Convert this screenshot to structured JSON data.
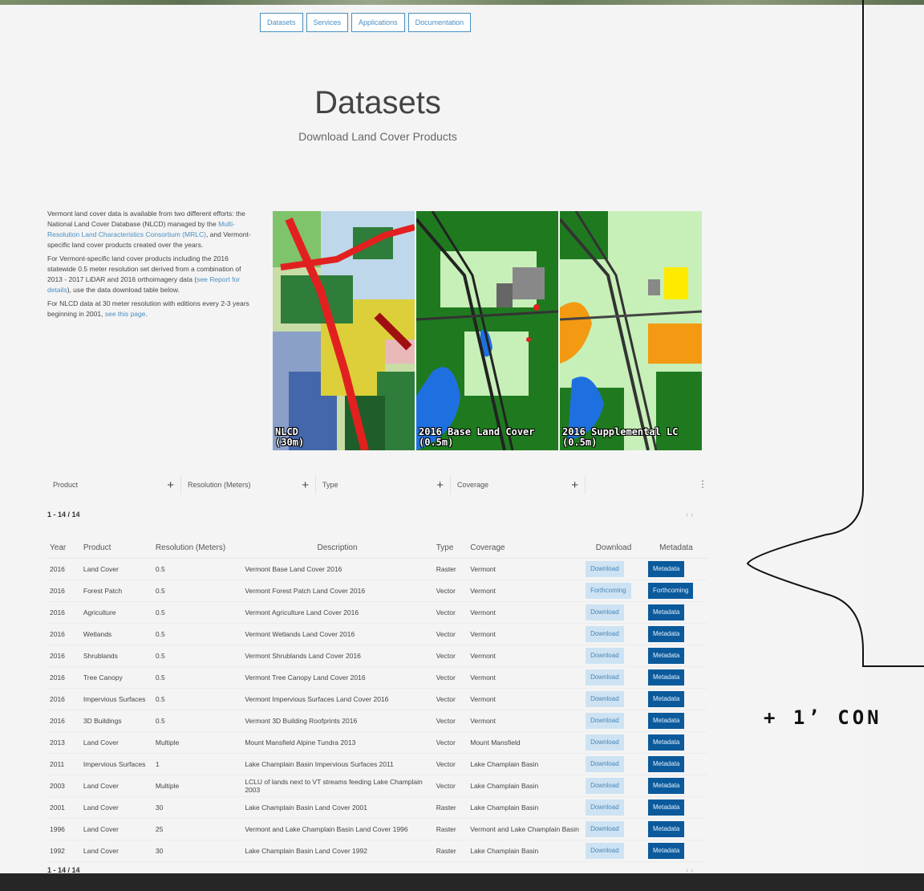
{
  "nav": [
    "Datasets",
    "Services",
    "Applications",
    "Documentation"
  ],
  "title": "Datasets",
  "subtitle": "Download Land Cover Products",
  "intro": {
    "p1a": "Vermont land cover data is available from two different efforts: the National Land Cover Database (NLCD) managed by the ",
    "p1link": "Multi-Resolution Land Characteristics Consortium (MRLC)",
    "p1b": ", and Vermont-specific land cover products created over the years.",
    "p2a": "For Vermont-specific land cover products including the 2016 statewide 0.5 meter resolution set derived from a combination of 2013 - 2017 LiDAR and 2016 orthoimagery data (",
    "p2link": "see Report for details",
    "p2b": "), use the data download table below.",
    "p3a": "For NLCD data at 30 meter resolution with editions every 2-3 years beginning in 2001, ",
    "p3link": "see this page",
    "p3b": "."
  },
  "maps": [
    {
      "line1": "NLCD",
      "line2": "(30m)"
    },
    {
      "line1": "2016 Base Land Cover",
      "line2": "(0.5m)"
    },
    {
      "line1": "2016 Supplemental LC",
      "line2": "(0.5m)"
    }
  ],
  "filters": [
    "Product",
    "Resolution (Meters)",
    "Type",
    "Coverage"
  ],
  "filter_plus": "+",
  "kebab": "⋮",
  "count_label": "1 - 14 / 14",
  "pager": "‹ ›",
  "table": {
    "headers": [
      "Year",
      "Product",
      "Resolution (Meters)",
      "Description",
      "Type",
      "Coverage",
      "Download",
      "Metadata"
    ],
    "rows": [
      [
        "2016",
        "Land Cover",
        "0.5",
        "Vermont Base Land Cover 2016",
        "Raster",
        "Vermont",
        "Download",
        "Metadata"
      ],
      [
        "2016",
        "Forest Patch",
        "0.5",
        "Vermont Forest Patch Land Cover 2016",
        "Vector",
        "Vermont",
        "Forthcoming",
        "Forthcoming"
      ],
      [
        "2016",
        "Agriculture",
        "0.5",
        "Vermont Agriculture Land Cover 2016",
        "Vector",
        "Vermont",
        "Download",
        "Metadata"
      ],
      [
        "2016",
        "Wetlands",
        "0.5",
        "Vermont Wetlands Land Cover 2016",
        "Vector",
        "Vermont",
        "Download",
        "Metadata"
      ],
      [
        "2016",
        "Shrublands",
        "0.5",
        "Vermont Shrublands Land Cover 2016",
        "Vector",
        "Vermont",
        "Download",
        "Metadata"
      ],
      [
        "2016",
        "Tree Canopy",
        "0.5",
        "Vermont Tree Canopy Land Cover 2016",
        "Vector",
        "Vermont",
        "Download",
        "Metadata"
      ],
      [
        "2016",
        "Impervious Surfaces",
        "0.5",
        "Vermont Impervious Surfaces Land Cover 2016",
        "Vector",
        "Vermont",
        "Download",
        "Metadata"
      ],
      [
        "2016",
        "3D Buildings",
        "0.5",
        "Vermont 3D Building Roofprints 2016",
        "Vector",
        "Vermont",
        "Download",
        "Metadata"
      ],
      [
        "2013",
        "Land Cover",
        "Multiple",
        "Mount Mansfield Alpine Tundra 2013",
        "Vector",
        "Mount Mansfield",
        "Download",
        "Metadata"
      ],
      [
        "2011",
        "Impervious Surfaces",
        "1",
        "Lake Champlain Basin Impervious Surfaces 2011",
        "Vector",
        "Lake Champlain Basin",
        "Download",
        "Metadata"
      ],
      [
        "2003",
        "Land Cover",
        "Multiple",
        "LCLU of lands next to VT streams feeding Lake Champlain 2003",
        "Vector",
        "Lake Champlain Basin",
        "Download",
        "Metadata"
      ],
      [
        "2001",
        "Land Cover",
        "30",
        "Lake Champlain Basin Land Cover 2001",
        "Raster",
        "Lake Champlain Basin",
        "Download",
        "Metadata"
      ],
      [
        "1996",
        "Land Cover",
        "25",
        "Vermont and Lake Champlain Basin Land Cover 1996",
        "Raster",
        "Vermont and Lake Champlain Basin",
        "Download",
        "Metadata"
      ],
      [
        "1992",
        "Land Cover",
        "30",
        "Lake Champlain Basin Land Cover 1992",
        "Raster",
        "Lake Champlain Basin",
        "Download",
        "Metadata"
      ]
    ]
  },
  "side_text": "+ 1’ CON",
  "colors": {
    "link": "#4a8fc1",
    "metadata_btn": "#0a5a9c",
    "download_btn": "#cde3f3"
  }
}
